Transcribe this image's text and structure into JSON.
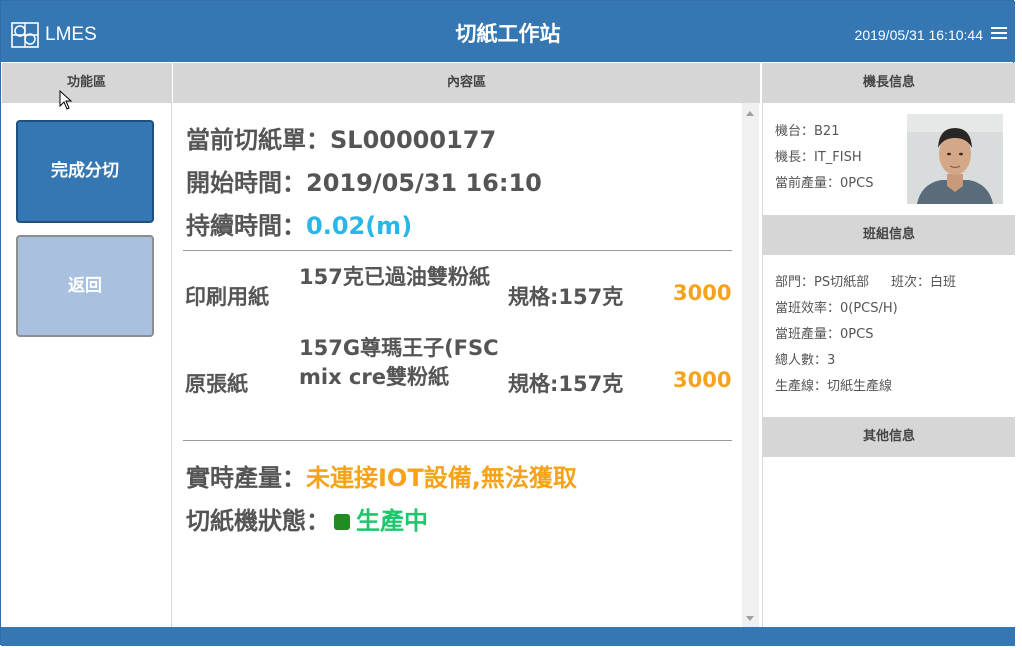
{
  "header": {
    "logo_text": "LMES",
    "title": "切紙工作站",
    "datetime": "2019/05/31 16:10:44"
  },
  "left": {
    "heading": "功能區",
    "complete_button": "完成分切",
    "back_button": "返回"
  },
  "middle": {
    "heading": "內容區",
    "order_label": "當前切紙單：",
    "order_value": "SL00000177",
    "start_label": "開始時間：",
    "start_value": "2019/05/31 16:10",
    "duration_label": "持續時間：",
    "duration_value": "0.02(m)",
    "materials": [
      {
        "label": "印刷用紙",
        "name": "157克已過油雙粉紙",
        "spec": "規格:157克",
        "qty": "3000"
      },
      {
        "label": "原張紙",
        "name": "157G尊瑪王子(FSC mix cre雙粉紙",
        "spec": "規格:157克",
        "qty": "3000"
      }
    ],
    "realtime_label": "實時產量：",
    "realtime_value": "未連接IOT設備,無法獲取",
    "machine_status_label": "切紙機狀態：",
    "machine_status_value": "生產中"
  },
  "right": {
    "leader_heading": "機長信息",
    "machine": "機台：B21",
    "leader": "機長：IT_FISH",
    "current_output": "當前產量：0PCS",
    "team_heading": "班組信息",
    "department": "部門：PS切紙部",
    "shift": "班次：白班",
    "shift_efficiency": "當班效率：0(PCS/H)",
    "shift_output": "當班產量：0PCS",
    "total_people": "總人數：3",
    "production_line": "生產線：切紙生產線",
    "other_heading": "其他信息"
  },
  "colors": {
    "brand_blue": "#3577b3",
    "duration_cyan": "#29b6ea",
    "warning_orange": "#f7a21b",
    "status_green": "#1ec76b",
    "status_dot": "#228b22"
  }
}
